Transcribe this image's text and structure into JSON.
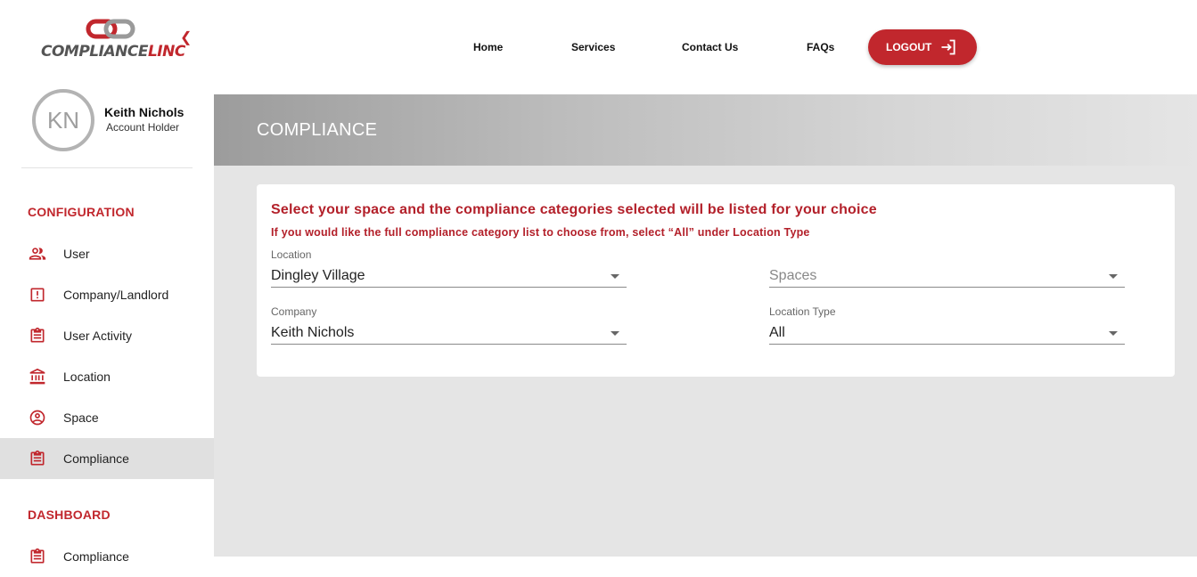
{
  "brand": {
    "logo_text_main": "COMPLIANCE",
    "logo_text_accent": "LINC",
    "accent_color": "#c1272d"
  },
  "sidebar": {
    "collapse_icon": "chevron-left-icon",
    "profile": {
      "initials": "KN",
      "name": "Keith Nichols",
      "role": "Account Holder"
    },
    "section_configuration": "CONFIGURATION",
    "config_items": [
      {
        "label": "User",
        "icon": "users-icon"
      },
      {
        "label": "Company/Landlord",
        "icon": "alert-box-icon"
      },
      {
        "label": "User Activity",
        "icon": "clipboard-icon"
      },
      {
        "label": "Location",
        "icon": "bank-icon"
      },
      {
        "label": "Space",
        "icon": "account-circle-icon"
      },
      {
        "label": "Compliance",
        "icon": "clipboard-icon",
        "active": true
      }
    ],
    "section_dashboard": "DASHBOARD",
    "dashboard_items": [
      {
        "label": "Compliance",
        "icon": "clipboard-icon"
      }
    ]
  },
  "topnav": {
    "home": "Home",
    "services": "Services",
    "contact": "Contact Us",
    "faqs": "FAQs",
    "logout": "LOGOUT"
  },
  "page": {
    "title": "COMPLIANCE",
    "heading": "Select your space and the compliance categories selected will be listed for your choice",
    "subheading": "If you would like the full compliance category list to choose from, select “All” under Location Type",
    "fields": {
      "location": {
        "label": "Location",
        "value": "Dingley Village"
      },
      "spaces": {
        "placeholder": "Spaces"
      },
      "company": {
        "label": "Company",
        "value": "Keith Nichols"
      },
      "location_type": {
        "label": "Location Type",
        "value": "All"
      }
    }
  }
}
